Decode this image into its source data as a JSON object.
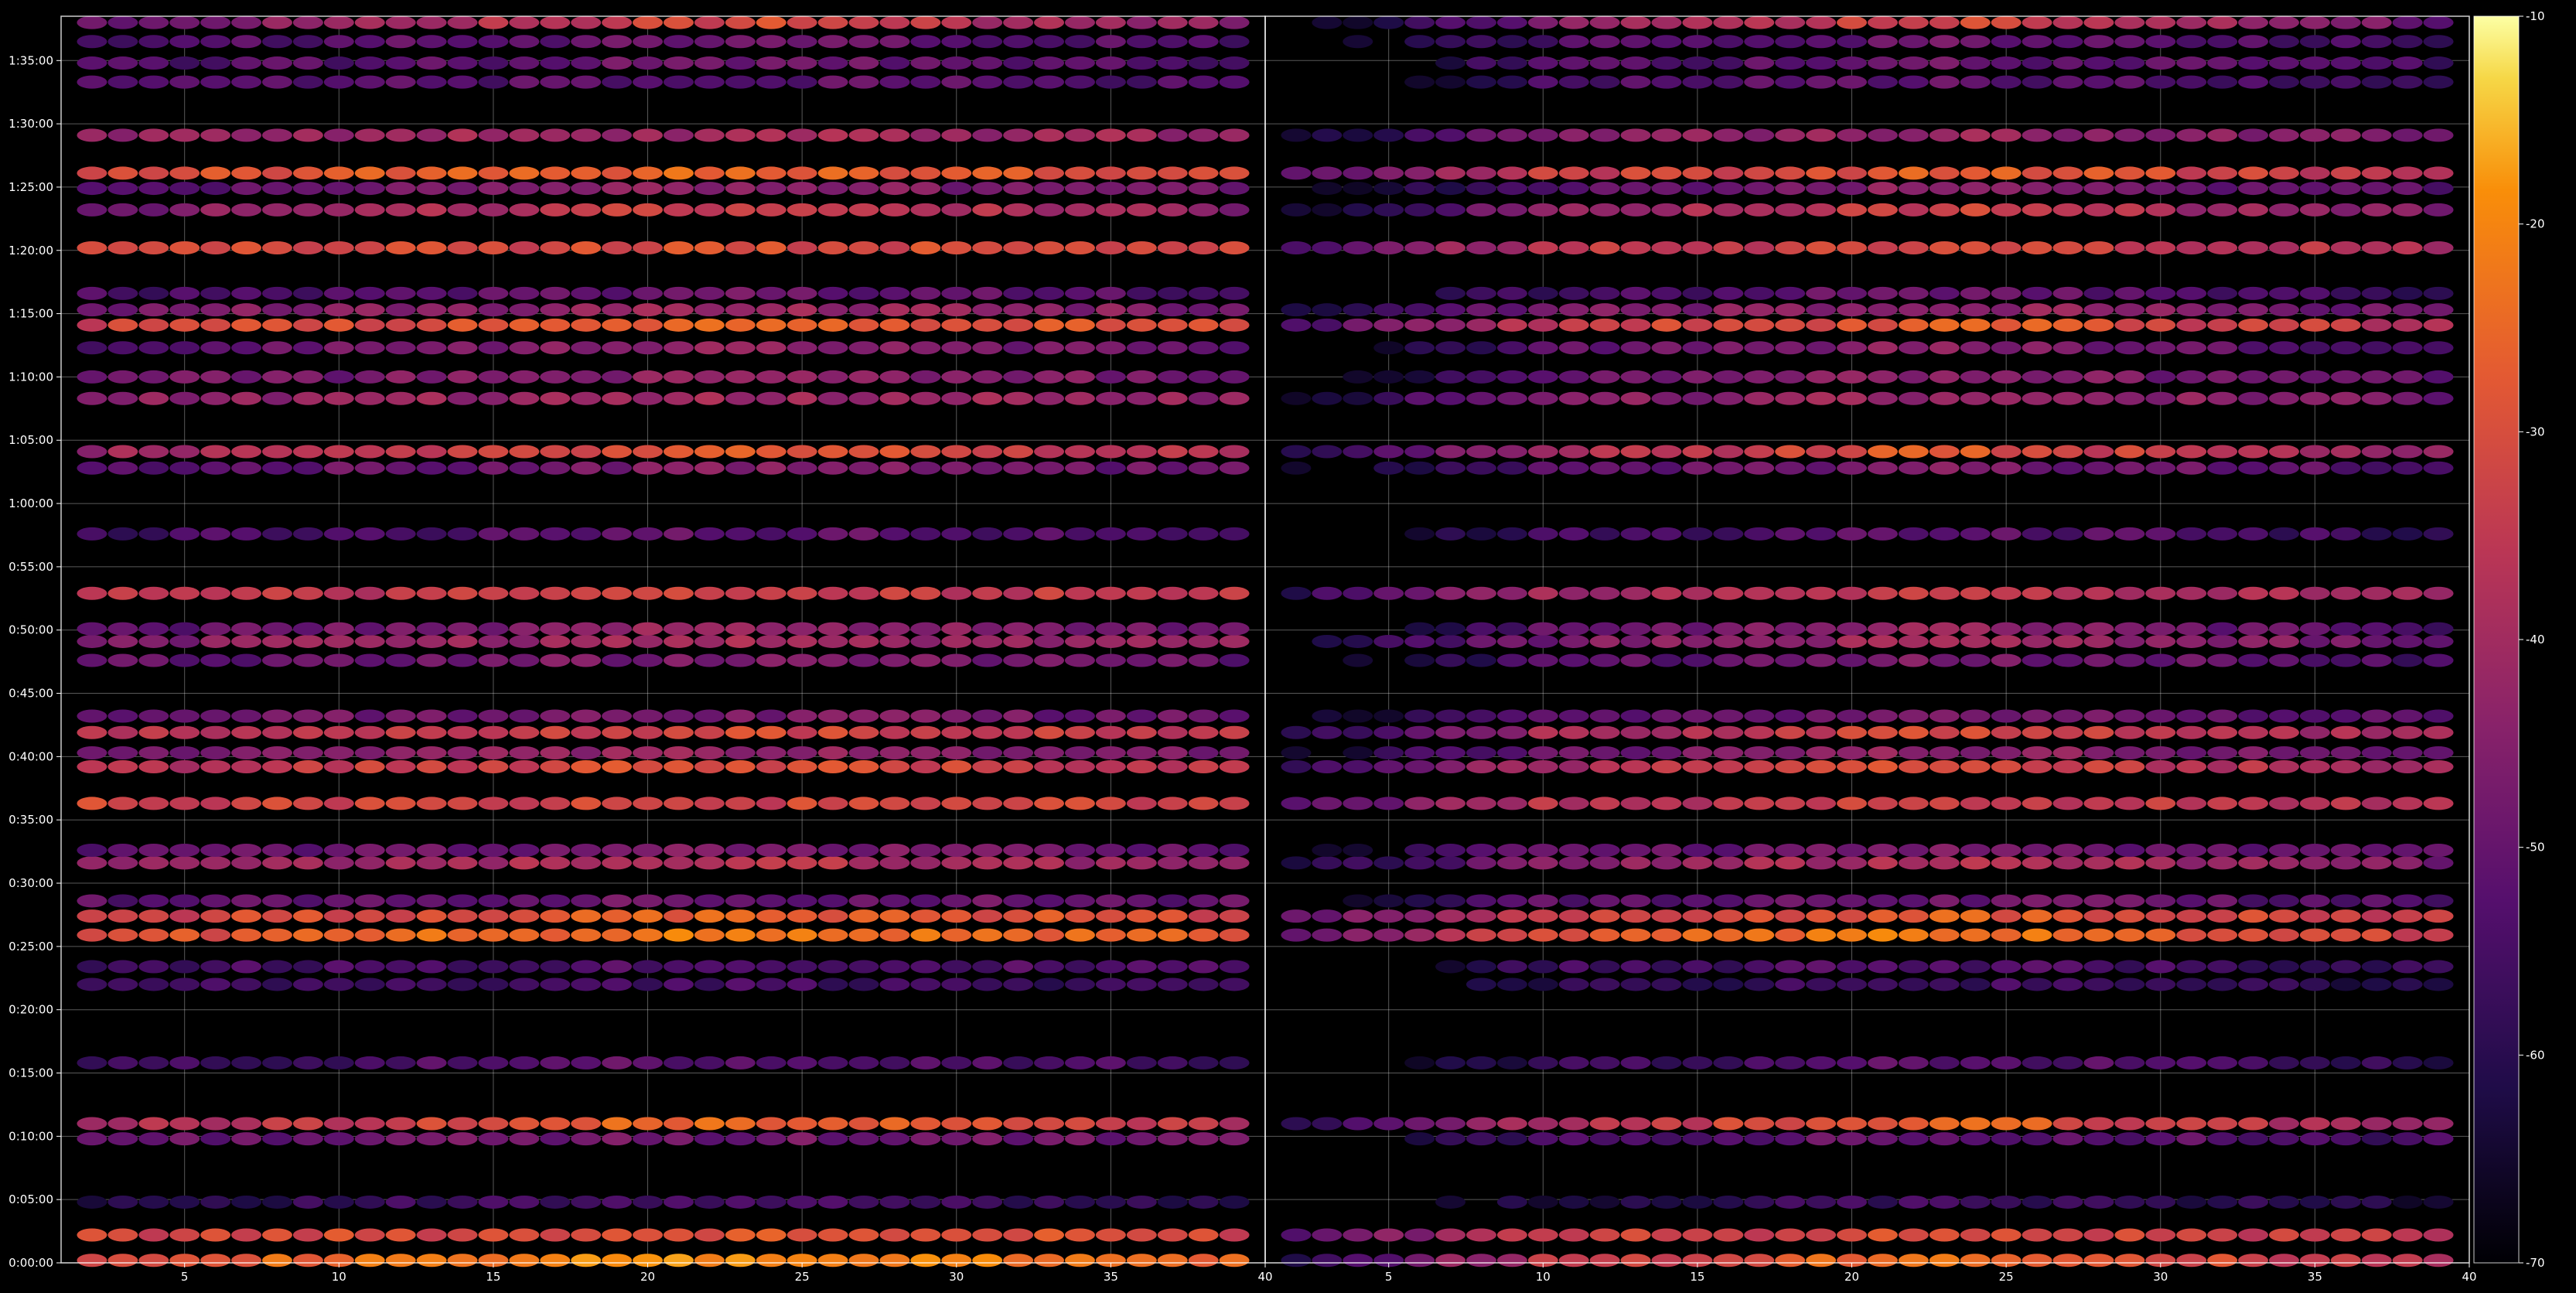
{
  "chart_data": {
    "type": "heatmap",
    "background": "#000000",
    "colormap": "inferno",
    "grid": true,
    "colorbar": {
      "position": "right",
      "range": [
        -70,
        -10
      ],
      "ticks": [
        "-10",
        "-20",
        "-30",
        "-40",
        "-50",
        "-60",
        "-70"
      ]
    },
    "panels": [
      {
        "id": "left",
        "xlim": [
          1,
          40
        ],
        "x_ticks": [
          "5",
          "10",
          "15",
          "20",
          "25",
          "30",
          "35",
          "40"
        ]
      },
      {
        "id": "right",
        "xlim": [
          1,
          40
        ],
        "x_ticks": [
          "5",
          "10",
          "15",
          "20",
          "25",
          "30",
          "35",
          "40"
        ]
      }
    ],
    "y_axis": {
      "range_minutes": [
        0,
        98.5
      ],
      "ticks": [
        "0:00:00",
        "0:05:00",
        "0:10:00",
        "0:15:00",
        "0:20:00",
        "0:25:00",
        "0:30:00",
        "0:35:00",
        "0:40:00",
        "0:45:00",
        "0:50:00",
        "0:55:00",
        "1:00:00",
        "1:05:00",
        "1:10:00",
        "1:15:00",
        "1:20:00",
        "1:25:00",
        "1:30:00",
        "1:35:00"
      ]
    },
    "columns": [
      2,
      3,
      4,
      5,
      6,
      7,
      8,
      9,
      10,
      11,
      12,
      13,
      14,
      15,
      16,
      17,
      18,
      19,
      20,
      21,
      22,
      23,
      24,
      25,
      26,
      27,
      28,
      29,
      30,
      31,
      32,
      33,
      34,
      35,
      36,
      37,
      38,
      39
    ],
    "bands": [
      {
        "t": 0.2,
        "left": -28,
        "right": -45,
        "peak": -18
      },
      {
        "t": 2.2,
        "left": -32,
        "right": -38,
        "peak": -28
      },
      {
        "t": 4.8,
        "left": -60,
        "right": -65,
        "peak": -55
      },
      {
        "t": 9.8,
        "left": -50,
        "right": -58,
        "peak": -48
      },
      {
        "t": 11.0,
        "left": -40,
        "right": -48,
        "peak": -22
      },
      {
        "t": 15.8,
        "left": -58,
        "right": -62,
        "peak": -50
      },
      {
        "t": 22.0,
        "left": -58,
        "right": -63,
        "peak": -55
      },
      {
        "t": 23.4,
        "left": -56,
        "right": -60,
        "peak": -52
      },
      {
        "t": 25.9,
        "left": -30,
        "right": -36,
        "peak": -20
      },
      {
        "t": 27.4,
        "left": -33,
        "right": -38,
        "peak": -25
      },
      {
        "t": 28.6,
        "left": -52,
        "right": -55,
        "peak": -48
      },
      {
        "t": 31.6,
        "left": -45,
        "right": -50,
        "peak": -35
      },
      {
        "t": 32.6,
        "left": -52,
        "right": -55,
        "peak": -45
      },
      {
        "t": 36.3,
        "left": -32,
        "right": -40,
        "peak": -32
      },
      {
        "t": 39.2,
        "left": -38,
        "right": -45,
        "peak": -28
      },
      {
        "t": 40.3,
        "left": -48,
        "right": -52,
        "peak": -42
      },
      {
        "t": 41.9,
        "left": -38,
        "right": -45,
        "peak": -30
      },
      {
        "t": 43.2,
        "left": -50,
        "right": -55,
        "peak": -46
      },
      {
        "t": 47.6,
        "left": -52,
        "right": -58,
        "peak": -45
      },
      {
        "t": 49.1,
        "left": -46,
        "right": -52,
        "peak": -38
      },
      {
        "t": 50.1,
        "left": -53,
        "right": -58,
        "peak": -40
      },
      {
        "t": 52.9,
        "left": -36,
        "right": -45,
        "peak": -33
      },
      {
        "t": 57.6,
        "left": -56,
        "right": -60,
        "peak": -50
      },
      {
        "t": 62.8,
        "left": -52,
        "right": -55,
        "peak": -45
      },
      {
        "t": 64.1,
        "left": -42,
        "right": -48,
        "peak": -25
      },
      {
        "t": 68.3,
        "left": -44,
        "right": -50,
        "peak": -40
      },
      {
        "t": 70.0,
        "left": -50,
        "right": -55,
        "peak": -42
      },
      {
        "t": 72.3,
        "left": -52,
        "right": -58,
        "peak": -42
      },
      {
        "t": 74.1,
        "left": -33,
        "right": -40,
        "peak": -25
      },
      {
        "t": 75.3,
        "left": -48,
        "right": -52,
        "peak": -40
      },
      {
        "t": 76.6,
        "left": -55,
        "right": -60,
        "peak": -48
      },
      {
        "t": 80.2,
        "left": -32,
        "right": -40,
        "peak": -30
      },
      {
        "t": 83.2,
        "left": -48,
        "right": -52,
        "peak": -30
      },
      {
        "t": 84.9,
        "left": -52,
        "right": -56,
        "peak": -42
      },
      {
        "t": 86.1,
        "left": -30,
        "right": -40,
        "peak": -25
      },
      {
        "t": 89.1,
        "left": -42,
        "right": -50,
        "peak": -40
      },
      {
        "t": 93.3,
        "left": -55,
        "right": -58,
        "peak": -50
      },
      {
        "t": 94.8,
        "left": -55,
        "right": -58,
        "peak": -48
      },
      {
        "t": 96.5,
        "left": -55,
        "right": -58,
        "peak": -48
      },
      {
        "t": 98.0,
        "left": -50,
        "right": -55,
        "peak": -28
      }
    ]
  }
}
